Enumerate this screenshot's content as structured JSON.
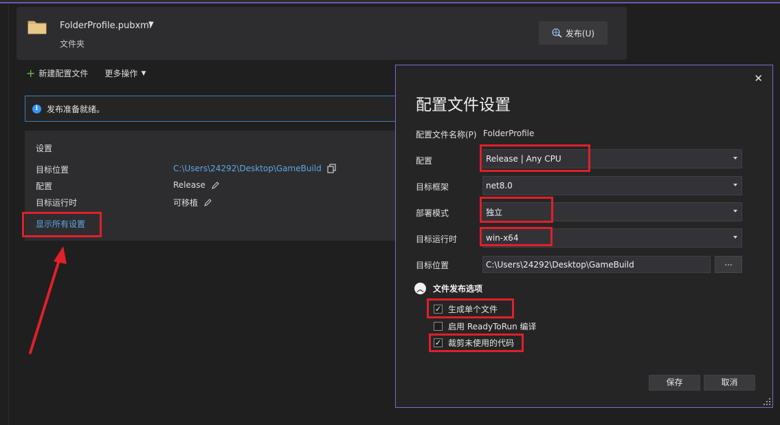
{
  "colors": {
    "accent_link": "#5fa7e0",
    "highlight_red": "#e0202a",
    "dialog_border": "#7f6ad1",
    "info_border": "#3c7fb1"
  },
  "header": {
    "profile_name": "FolderProfile.pubxml",
    "profile_type": "文件夹",
    "publish_label": "发布(U)",
    "icons": [
      "folder-icon",
      "publish-globe-icon",
      "caret-down-icon"
    ]
  },
  "toolbar": {
    "new_profile": "新建配置文件",
    "more_actions": "更多操作"
  },
  "infobar": {
    "message": "发布准备就绪。"
  },
  "settings": {
    "title": "设置",
    "rows": [
      {
        "label": "目标位置",
        "value": "C:\\Users\\24292\\Desktop\\GameBuild"
      },
      {
        "label": "配置",
        "value": "Release"
      },
      {
        "label": "目标运行时",
        "value": "可移植"
      }
    ],
    "show_all": "显示所有设置"
  },
  "dialog": {
    "title": "配置文件设置",
    "close": "✕",
    "profile_name_label": "配置文件名称(P)",
    "profile_name_value": "FolderProfile",
    "config_label": "配置",
    "config_value": "Release | Any CPU",
    "framework_label": "目标框架",
    "framework_value": "net8.0",
    "deploy_label": "部署模式",
    "deploy_value": "独立",
    "runtime_label": "目标运行时",
    "runtime_value": "win-x64",
    "location_label": "目标位置",
    "location_value": "C:\\Users\\24292\\Desktop\\GameBuild",
    "browse": "...",
    "section_title": "文件发布选项",
    "options": [
      {
        "label": "生成单个文件",
        "checked": true
      },
      {
        "label": "启用 ReadyToRun 编译",
        "checked": false
      },
      {
        "label": "裁剪未使用的代码",
        "checked": true
      }
    ],
    "save": "保存",
    "cancel": "取消"
  }
}
